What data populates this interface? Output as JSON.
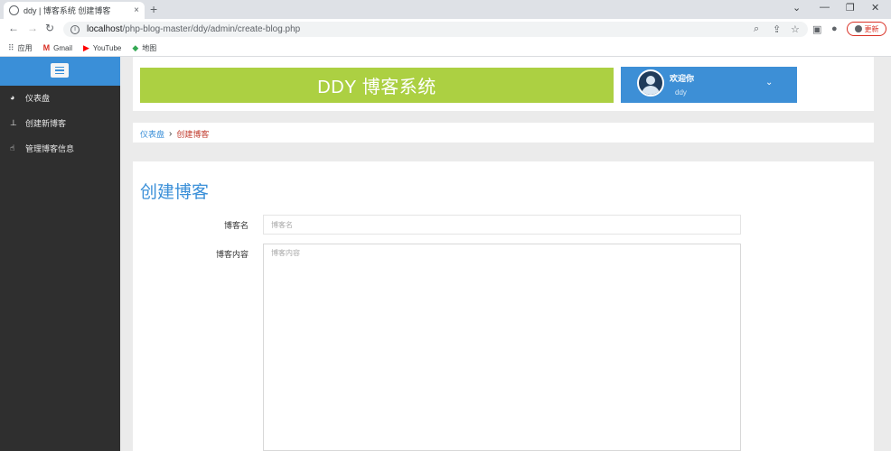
{
  "browser": {
    "tab_title": "ddy | 博客系统 创建博客",
    "tab_close": "×",
    "new_tab": "+",
    "url_host": "localhost",
    "url_path": "/php-blog-master/ddy/admin/create-blog.php",
    "update_label": "更新",
    "bookmarks": [
      {
        "label": "应用",
        "icon": "apps-icon"
      },
      {
        "label": "Gmail",
        "icon": "gmail-icon"
      },
      {
        "label": "YouTube",
        "icon": "youtube-icon"
      },
      {
        "label": "地图",
        "icon": "maps-icon"
      }
    ]
  },
  "sidebar": {
    "items": [
      {
        "label": "仪表盘",
        "icon": "dashboard-icon"
      },
      {
        "label": "创建新博客",
        "icon": "pin-icon"
      },
      {
        "label": "管理博客信息",
        "icon": "thumbs-up-icon"
      }
    ]
  },
  "header": {
    "banner_title": "DDY 博客系统",
    "welcome": "欢迎你",
    "username": "ddy"
  },
  "breadcrumb": {
    "home": "仪表盘",
    "separator": "›",
    "current": "创建博客"
  },
  "form": {
    "title": "创建博客",
    "name_label": "博客名",
    "name_placeholder": "博客名",
    "content_label": "博客内容",
    "content_placeholder": "博客内容"
  },
  "colors": {
    "sidebar_bg": "#2f2f2f",
    "accent_blue": "#3a8fd8",
    "banner_green": "#acd042",
    "crumb_current": "#c0392b"
  }
}
